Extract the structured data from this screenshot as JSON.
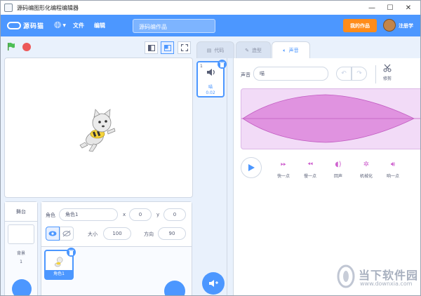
{
  "window": {
    "title": "源码编图形化编程编辑器"
  },
  "menubar": {
    "logo_text": "源码猫",
    "menu_file": "文件",
    "menu_edit": "编辑",
    "project_title": "源码编作品",
    "my_works": "我的作品",
    "register": "注册学"
  },
  "stage_panel": {
    "label": "舞台",
    "backdrop_label": "背景",
    "backdrop_count": "1"
  },
  "sprite": {
    "name_label": "角色",
    "name": "角色1",
    "x_label": "x",
    "x": "0",
    "y_label": "y",
    "y": "0",
    "size_label": "大小",
    "size": "100",
    "direction_label": "方向",
    "direction": "90",
    "tile_name": "角色1"
  },
  "tabs": {
    "code": "代码",
    "costumes": "造型",
    "sounds": "声音"
  },
  "sound_tile": {
    "index": "1",
    "name": "喵",
    "duration": "0.02"
  },
  "sound_editor": {
    "sound_label": "声音",
    "sound_name": "喵",
    "trim": "修剪",
    "effects": [
      "快一点",
      "慢一点",
      "回声",
      "机械化",
      "响一点"
    ]
  },
  "watermark": {
    "name": "当下软件园",
    "url": "www.downxia.com"
  },
  "colors": {
    "accent": "#4c97ff",
    "orange": "#ff8c1a",
    "sound": "#cf63cf",
    "stop": "#ec5959"
  }
}
